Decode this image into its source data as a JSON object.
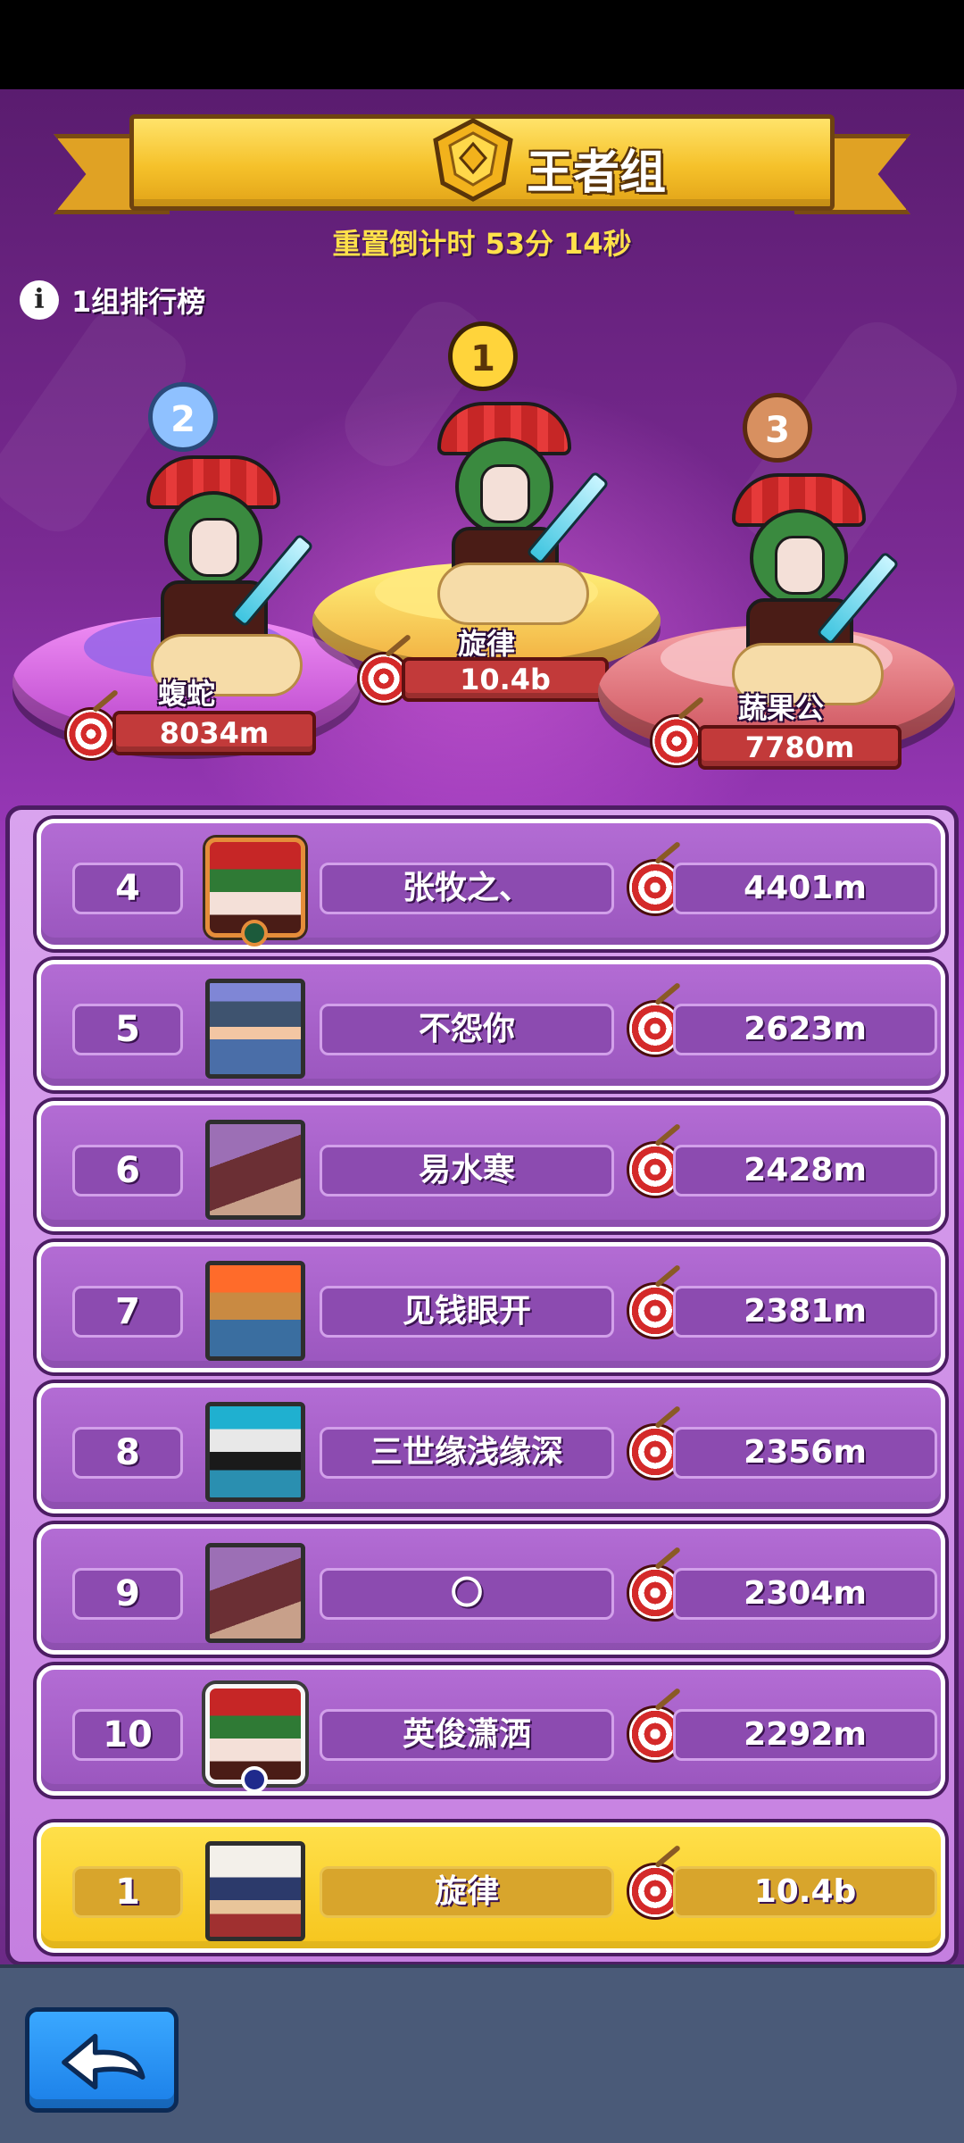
{
  "header": {
    "title": "王者组",
    "countdown": "重置倒计时 53分 14秒",
    "group_label": "1组排行榜",
    "info_icon": "i"
  },
  "podium": [
    {
      "rank": "1",
      "name": "旋律",
      "score": "10.4b"
    },
    {
      "rank": "2",
      "name": "蝮蛇",
      "score": "8034m"
    },
    {
      "rank": "3",
      "name": "蔬果公",
      "score": "7780m"
    }
  ],
  "rows": [
    {
      "rank": "4",
      "name": "张牧之、",
      "score": "4401m",
      "avatar": "opera-hero"
    },
    {
      "rank": "5",
      "name": "不怨你",
      "score": "2623m",
      "avatar": "soldier-hero"
    },
    {
      "rank": "6",
      "name": "易水寒",
      "score": "2428m",
      "avatar": "bug-hero"
    },
    {
      "rank": "7",
      "name": "见钱眼开",
      "score": "2381m",
      "avatar": "mech-hero"
    },
    {
      "rank": "8",
      "name": "三世缘浅缘深",
      "score": "2356m",
      "avatar": "knight-hero"
    },
    {
      "rank": "9",
      "name": "〇",
      "score": "2304m",
      "avatar": "bug-hero"
    },
    {
      "rank": "10",
      "name": "英俊潇洒",
      "score": "2292m",
      "avatar": "opera-hero"
    }
  ],
  "my_row": {
    "rank": "1",
    "name": "旋律",
    "score": "10.4b",
    "avatar": "mage-hero"
  },
  "colors": {
    "banner": "#f5c12a",
    "countdown": "#ffe14a",
    "row_bg": "#9a56be",
    "my_row_bg": "#f6c51d",
    "back_button": "#1b7fe8"
  },
  "icons": {
    "target": "target-icon",
    "back": "back-arrow-icon",
    "info": "info-icon"
  }
}
